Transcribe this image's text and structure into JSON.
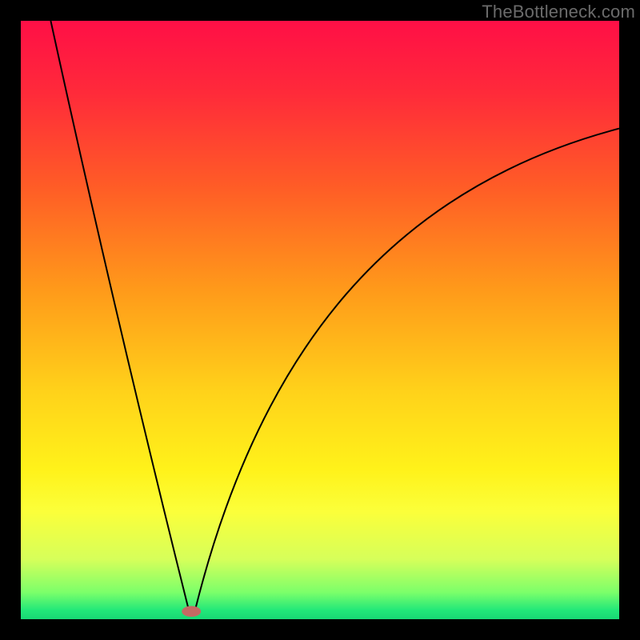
{
  "watermark": "TheBottleneck.com",
  "chart_data": {
    "type": "line",
    "title": "",
    "xlabel": "",
    "ylabel": "",
    "xlim": [
      0,
      100
    ],
    "ylim": [
      0,
      100
    ],
    "gradient_stops": [
      {
        "offset": 0.0,
        "color": "#ff0f46"
      },
      {
        "offset": 0.12,
        "color": "#ff2a3a"
      },
      {
        "offset": 0.28,
        "color": "#ff5d26"
      },
      {
        "offset": 0.45,
        "color": "#ff9a1a"
      },
      {
        "offset": 0.62,
        "color": "#ffd21a"
      },
      {
        "offset": 0.75,
        "color": "#fff21a"
      },
      {
        "offset": 0.82,
        "color": "#fbff3a"
      },
      {
        "offset": 0.9,
        "color": "#d6ff5a"
      },
      {
        "offset": 0.955,
        "color": "#7cff6a"
      },
      {
        "offset": 0.985,
        "color": "#22e879"
      },
      {
        "offset": 1.0,
        "color": "#18d874"
      }
    ],
    "apex": {
      "x": 28.5,
      "y": 1.5
    },
    "left_branch": {
      "x0": 5.0,
      "y0": 100.0,
      "x1": 28.0,
      "y1": 1.8,
      "curvature": 0.05
    },
    "right_branch": {
      "x0": 29.2,
      "y0": 1.8,
      "x1": 100.0,
      "y1": 82.0,
      "control1": {
        "x": 40.0,
        "y": 45.0
      },
      "control2": {
        "x": 62.0,
        "y": 72.0
      }
    },
    "marker": {
      "cx": 28.5,
      "cy": 1.3,
      "rx": 1.6,
      "ry": 0.9,
      "color": "#c56a63"
    },
    "curve_color": "#000000",
    "curve_width": 2.0
  }
}
